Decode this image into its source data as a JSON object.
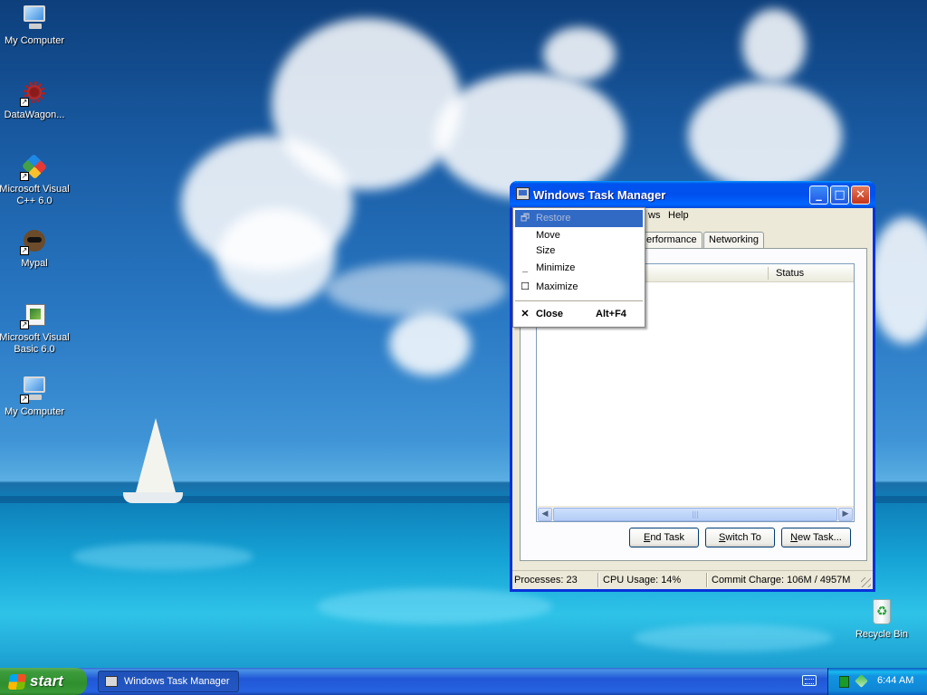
{
  "desktop": {
    "icons": [
      {
        "label": "My Computer",
        "icon": "computer-icon"
      },
      {
        "label": "DataWagon...",
        "icon": "flower-icon"
      },
      {
        "label": "Microsoft Visual C++ 6.0",
        "icon": "visual-cpp-icon"
      },
      {
        "label": "Mypal",
        "icon": "raccoon-icon"
      },
      {
        "label": "Microsoft Visual Basic 6.0",
        "icon": "visual-basic-icon"
      },
      {
        "label": "My Computer",
        "icon": "computer-icon"
      },
      {
        "label": "Recycle Bin",
        "icon": "recycle-bin-icon"
      }
    ]
  },
  "window": {
    "title": "Windows Task Manager",
    "menu": {
      "partial_windows": "ws",
      "help": "Help"
    },
    "tabs": {
      "performance_partial": "erformance",
      "networking": "Networking"
    },
    "list": {
      "column_status": "Status"
    },
    "buttons": {
      "end_task_u": "E",
      "end_task_rest": "nd Task",
      "switch_to_u": "S",
      "switch_to_rest": "witch To",
      "new_task_u": "N",
      "new_task_rest": "ew Task..."
    },
    "status": {
      "processes": "Processes: 23",
      "cpu": "CPU Usage: 14%",
      "commit": "Commit Charge: 106M / 4957M"
    }
  },
  "system_menu": {
    "restore": "Restore",
    "move": "Move",
    "size": "Size",
    "minimize": "Minimize",
    "maximize": "Maximize",
    "close": "Close",
    "close_shortcut": "Alt+F4"
  },
  "taskbar": {
    "start_label": "start",
    "task_label": "Windows Task Manager",
    "clock": "6:44 AM"
  },
  "colors": {
    "title_blue": "#0053ee",
    "start_green": "#3c9c3c",
    "menu_highlight": "#316ac5"
  }
}
